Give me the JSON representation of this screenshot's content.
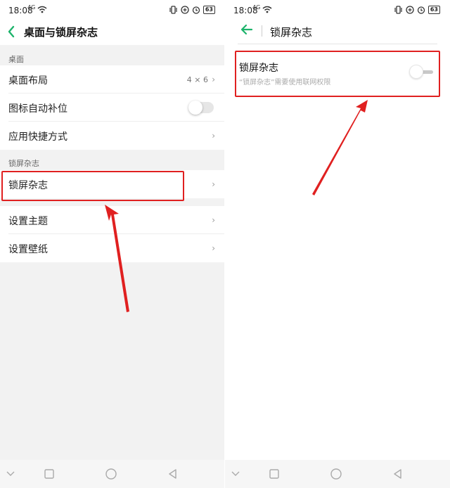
{
  "status": {
    "time": "18:08",
    "signal": "4G",
    "battery": "63"
  },
  "left": {
    "title": "桌面与锁屏杂志",
    "sections": {
      "desktop": "桌面",
      "lockscreen": "锁屏杂志"
    },
    "rows": {
      "layout": {
        "label": "桌面布局",
        "value": "4 × 6"
      },
      "auto_fill": {
        "label": "图标自动补位",
        "enabled": false
      },
      "shortcuts": {
        "label": "应用快捷方式"
      },
      "lock_magazine": {
        "label": "锁屏杂志"
      },
      "theme": {
        "label": "设置主题"
      },
      "wallpaper": {
        "label": "设置壁纸"
      }
    }
  },
  "right": {
    "title": "锁屏杂志",
    "setting": {
      "label": "锁屏杂志",
      "desc": "“锁屏杂志”需要使用联网权限",
      "enabled": false
    }
  },
  "colors": {
    "accent": "#1db36b",
    "highlight": "#e02020"
  }
}
